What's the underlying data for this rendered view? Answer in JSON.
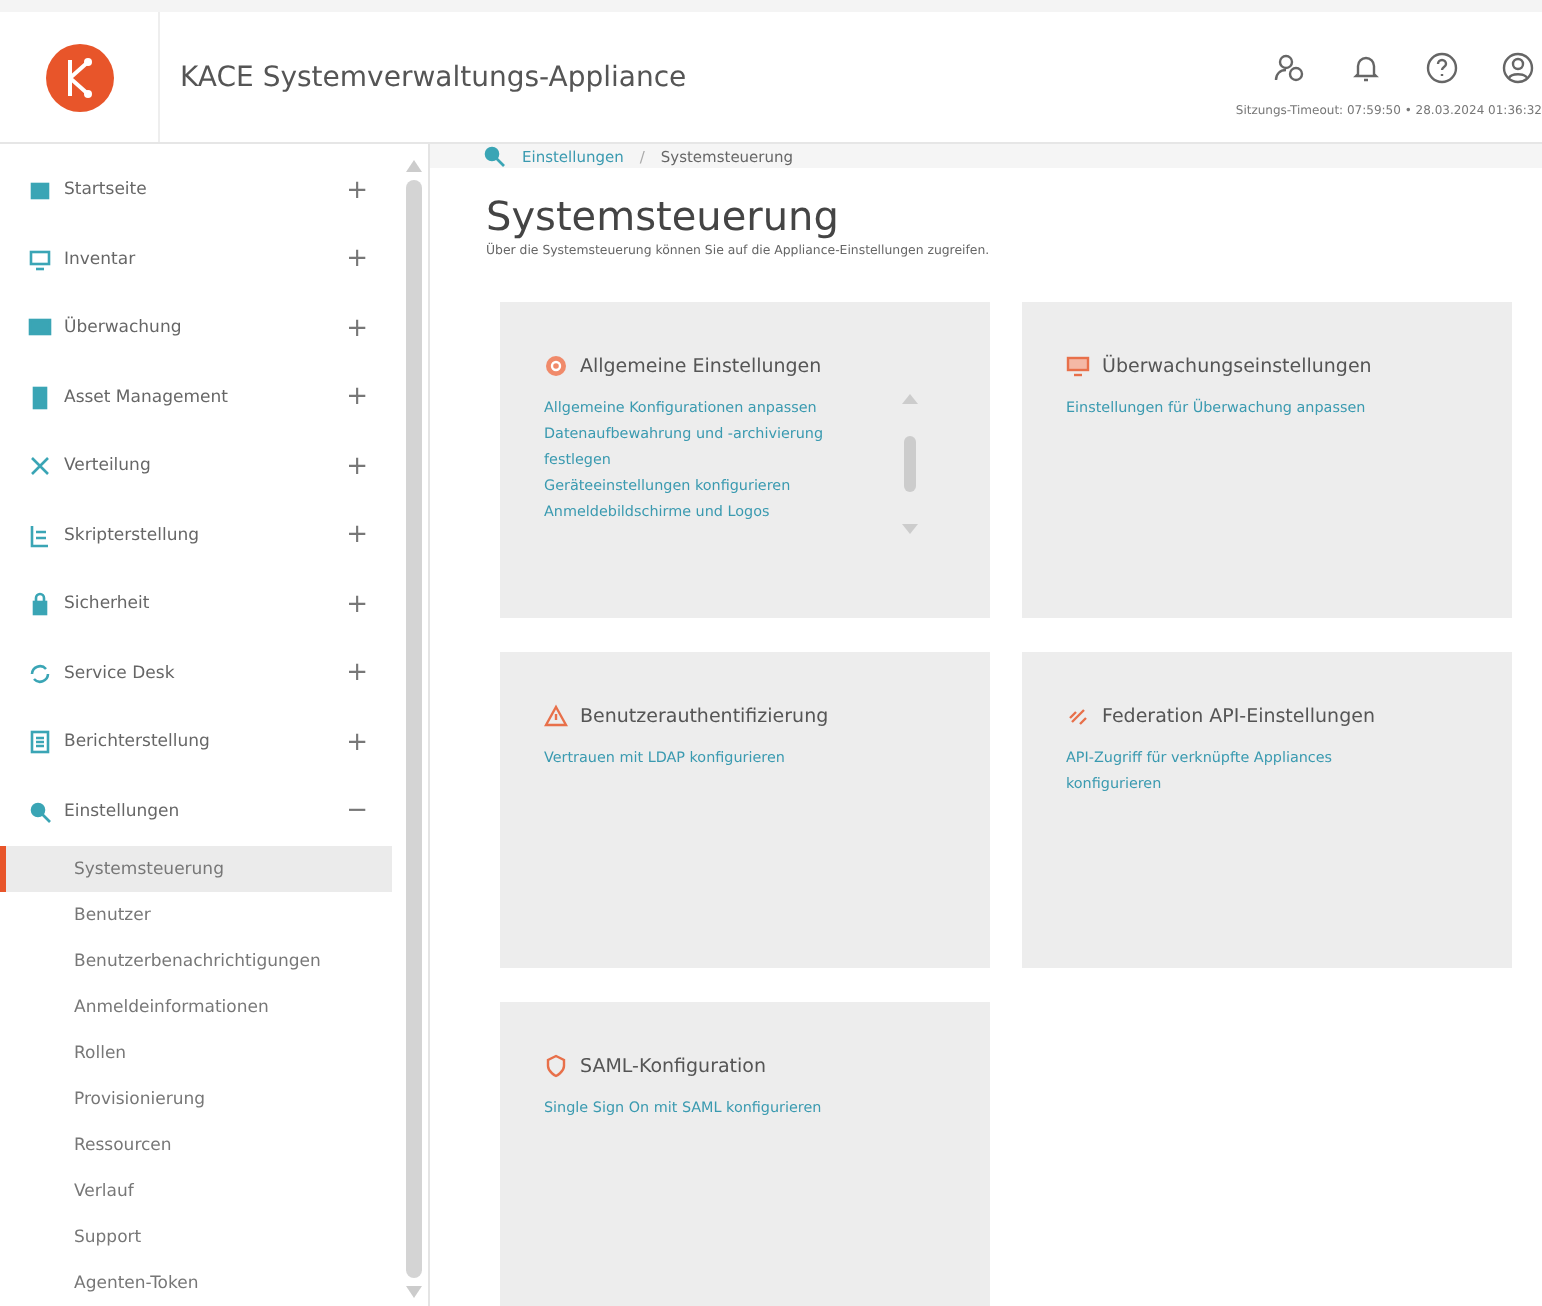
{
  "header": {
    "title": "KACE Systemverwaltungs-Appliance",
    "session": "Sitzungs-Timeout: 07:59:50 • 28.03.2024 01:36:32"
  },
  "sidebar": {
    "items": [
      {
        "label": "Startseite",
        "toggle": "+"
      },
      {
        "label": "Inventar",
        "toggle": "+"
      },
      {
        "label": "Überwachung",
        "toggle": "+"
      },
      {
        "label": "Asset Management",
        "toggle": "+"
      },
      {
        "label": "Verteilung",
        "toggle": "+"
      },
      {
        "label": "Skripterstellung",
        "toggle": "+"
      },
      {
        "label": "Sicherheit",
        "toggle": "+"
      },
      {
        "label": "Service Desk",
        "toggle": "+"
      },
      {
        "label": "Berichterstellung",
        "toggle": "+"
      },
      {
        "label": "Einstellungen",
        "toggle": "−",
        "children": [
          {
            "label": "Systemsteuerung",
            "selected": true
          },
          {
            "label": "Benutzer",
            "selected": false
          },
          {
            "label": "Benutzerbenachrichtigungen",
            "selected": false
          },
          {
            "label": "Anmeldeinformationen",
            "selected": false
          },
          {
            "label": "Rollen",
            "selected": false
          },
          {
            "label": "Provisionierung",
            "selected": false
          },
          {
            "label": "Ressourcen",
            "selected": false
          },
          {
            "label": "Verlauf",
            "selected": false
          },
          {
            "label": "Support",
            "selected": false
          },
          {
            "label": "Agenten-Token",
            "selected": false
          }
        ]
      }
    ]
  },
  "breadcrumb": {
    "items": [
      "Einstellungen",
      "Systemsteuerung"
    ],
    "separator": "/"
  },
  "page": {
    "title": "Systemsteuerung",
    "subtitle": "Über die Systemsteuerung können Sie auf die Appliance-Einstellungen zugreifen."
  },
  "cards": [
    {
      "title": "Allgemeine Einstellungen",
      "scrollable": true,
      "links": [
        "Allgemeine Konfigurationen anpassen",
        "Datenaufbewahrung und -archivierung festlegen",
        "Geräteeinstellungen konfigurieren",
        "Anmeldebildschirme und Logos"
      ]
    },
    {
      "title": "Überwachungseinstellungen",
      "scrollable": false,
      "links": [
        "Einstellungen für Überwachung anpassen"
      ]
    },
    {
      "title": "Benutzerauthentifizierung",
      "scrollable": false,
      "links": [
        "Vertrauen mit LDAP konfigurieren"
      ]
    },
    {
      "title": "Federation API-Einstellungen",
      "scrollable": false,
      "links": [
        "API-Zugriff für verknüpfte Appliances konfigurieren"
      ]
    },
    {
      "title": "SAML-Konfiguration",
      "scrollable": false,
      "links": [
        "Single Sign On mit SAML konfigurieren"
      ]
    }
  ]
}
